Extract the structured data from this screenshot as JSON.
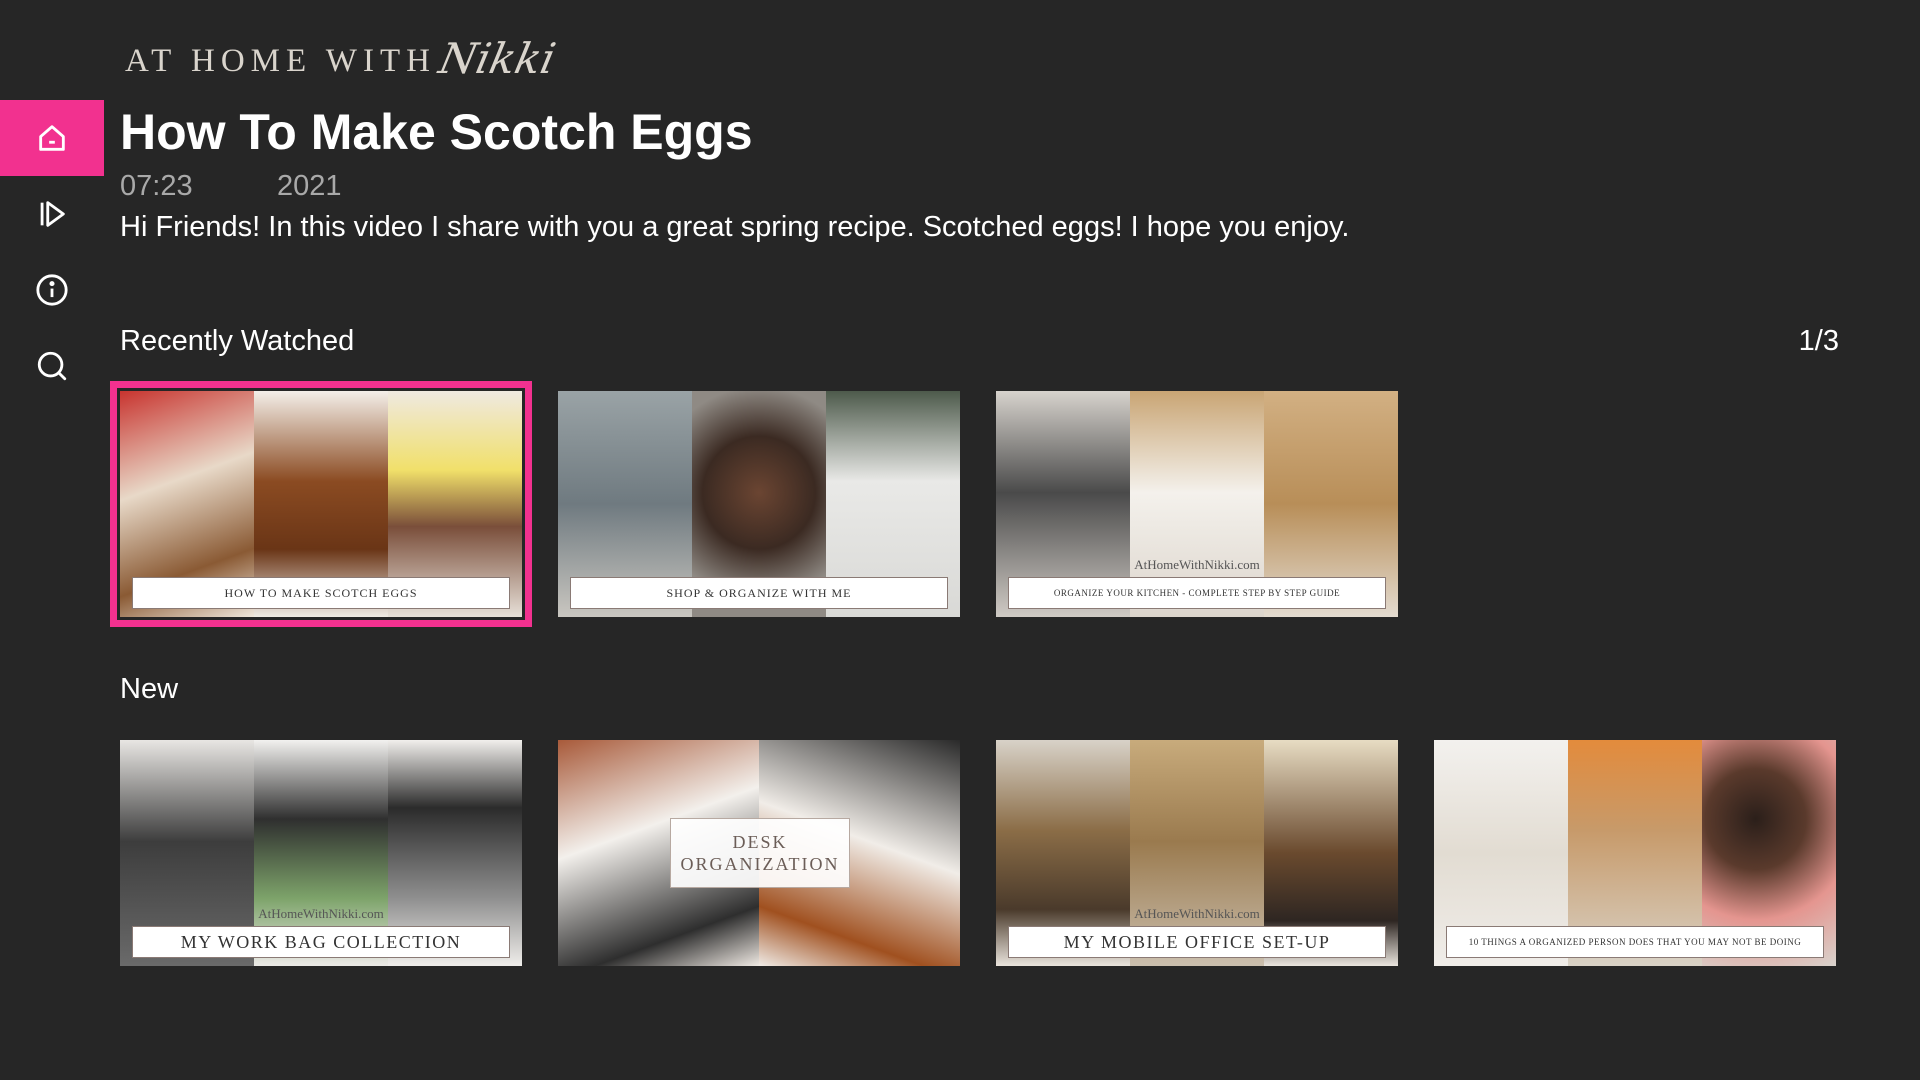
{
  "brand": {
    "caps": "AT HOME WITH",
    "script": "Nikki"
  },
  "sidebar": {
    "items": [
      {
        "icon": "home-icon",
        "active": true
      },
      {
        "icon": "play-icon",
        "active": false
      },
      {
        "icon": "info-icon",
        "active": false
      },
      {
        "icon": "search-icon",
        "active": false
      }
    ]
  },
  "colors": {
    "accent": "#f2318f",
    "background": "#262626"
  },
  "hero": {
    "title": "How To Make Scotch Eggs",
    "duration": "07:23",
    "year": "2021",
    "description": "Hi Friends!  In this video I share with you a great spring recipe.  Scotched eggs!  I hope you enjoy."
  },
  "rows": [
    {
      "heading": "Recently Watched",
      "counter": "1/3",
      "cards": [
        {
          "site": "",
          "caption": "HOW TO MAKE SCOTCH EGGS",
          "focused": true
        },
        {
          "site": "",
          "caption": "SHOP & ORGANIZE WITH ME",
          "focused": false
        },
        {
          "site": "AtHomeWithNikki.com",
          "caption": "ORGANIZE YOUR KITCHEN - COMPLETE STEP BY STEP GUIDE",
          "focused": false
        }
      ]
    },
    {
      "heading": "New",
      "cards": [
        {
          "site": "AtHomeWithNikki.com",
          "caption": "MY WORK BAG COLLECTION"
        },
        {
          "overlay_line1": "DESK",
          "overlay_line2": "ORGANIZATION"
        },
        {
          "site": "AtHomeWithNikki.com",
          "caption": "MY MOBILE OFFICE SET-UP"
        },
        {
          "caption": "10 THINGS A ORGANIZED PERSON DOES THAT YOU MAY NOT BE DOING"
        }
      ]
    }
  ]
}
